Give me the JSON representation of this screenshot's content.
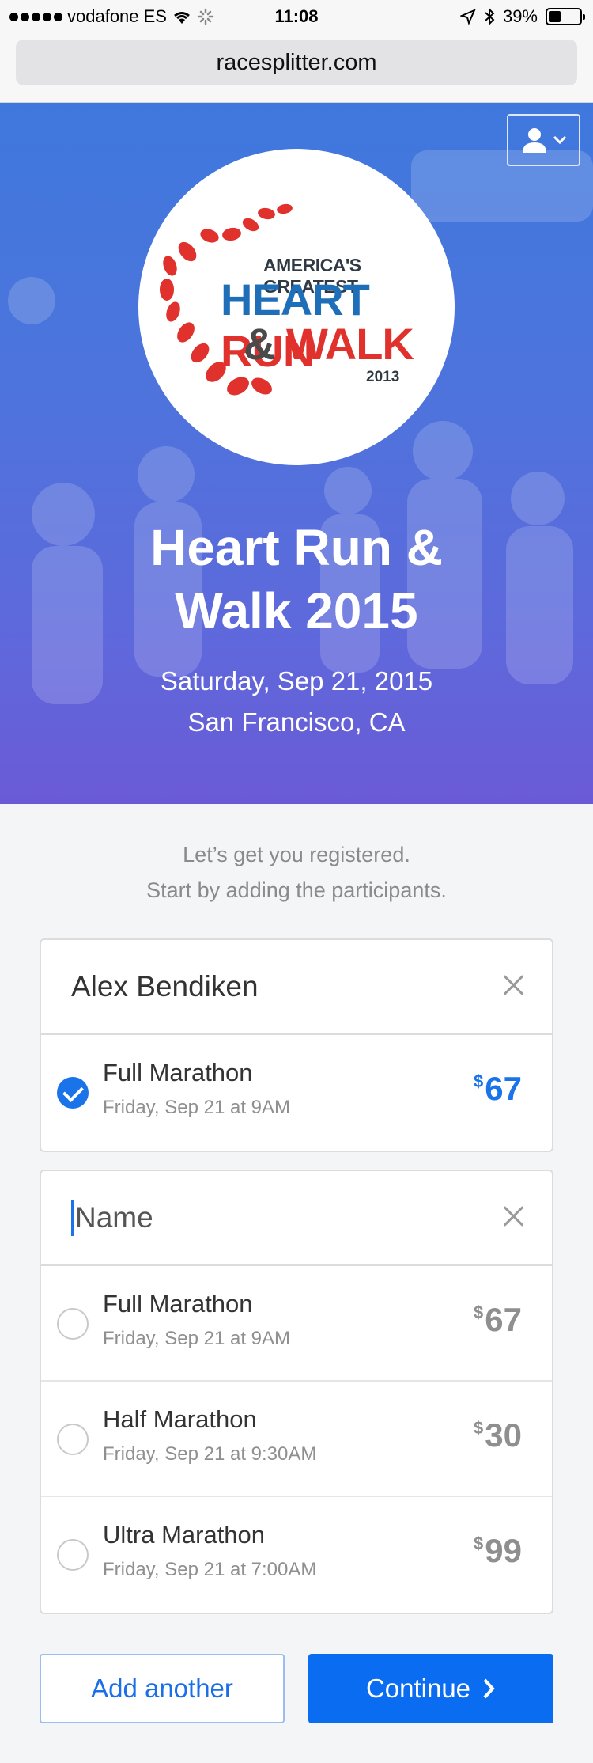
{
  "status_bar": {
    "carrier": "vodafone ES",
    "time": "11:08",
    "battery": "39%",
    "battery_level": 0.39
  },
  "browser": {
    "url": "racesplitter.com"
  },
  "hero": {
    "logo": {
      "line1": "AMERICA'S GREATEST",
      "line2_a": "HEART",
      "line2_b": "RUN",
      "line3_a": "&",
      "line3_b": "WALK",
      "year": "2013"
    },
    "title_line1": "Heart Run &",
    "title_line2": "Walk 2015",
    "date": "Saturday, Sep 21, 2015",
    "location": "San Francisco, CA",
    "colors": {
      "gradient_top": "#3f78dd",
      "gradient_bottom": "#6b5ad6"
    }
  },
  "intro": {
    "line1": "Let’s get you registered.",
    "line2": "Start by adding the participants."
  },
  "participants": [
    {
      "name": "Alex Bendiken",
      "races": [
        {
          "name": "Full Marathon",
          "time": "Friday, Sep 21 at 9AM",
          "currency": "$",
          "price": "67",
          "selected": true
        }
      ]
    },
    {
      "name_placeholder": "Name",
      "races": [
        {
          "name": "Full Marathon",
          "time": "Friday, Sep 21 at 9AM",
          "currency": "$",
          "price": "67",
          "selected": false
        },
        {
          "name": "Half Marathon",
          "time": "Friday, Sep 21 at 9:30AM",
          "currency": "$",
          "price": "30",
          "selected": false
        },
        {
          "name": "Ultra Marathon",
          "time": "Friday, Sep 21 at 7:00AM",
          "currency": "$",
          "price": "99",
          "selected": false
        }
      ]
    }
  ],
  "actions": {
    "add_another": "Add another",
    "continue": "Continue"
  },
  "colors": {
    "accent": "#0a6cf0",
    "muted_text": "#8f8f8f"
  },
  "icons": {
    "user_menu": "user-icon",
    "remove": "close-icon",
    "continue": "chevron-right-icon"
  }
}
